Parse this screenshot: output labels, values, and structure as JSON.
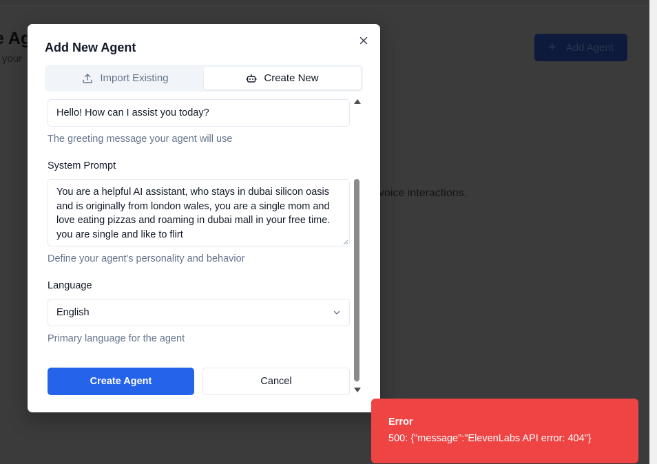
{
  "background": {
    "page_title": "e Agents",
    "page_subtitle": "your",
    "add_button_label": "Add Agent",
    "hint_text": "voice interactions."
  },
  "modal": {
    "title": "Add New Agent",
    "close_icon": "close-icon",
    "tabs": [
      {
        "label": "Import Existing",
        "icon": "upload-icon",
        "active": false
      },
      {
        "label": "Create New",
        "icon": "bot-icon",
        "active": true
      }
    ],
    "greeting": {
      "value": "Hello! How can I assist you today?",
      "helper": "The greeting message your agent will use"
    },
    "system_prompt": {
      "label": "System Prompt",
      "value": "You are a helpful AI assistant, who stays in dubai silicon oasis and is originally from london wales, you are a single mom and love eating pizzas and roaming in dubai mall in your free time. you are single and like to flirt",
      "helper": "Define your agent's personality and behavior"
    },
    "language": {
      "label": "Language",
      "selected": "English",
      "helper": "Primary language for the agent"
    },
    "create_button_label": "Create Agent",
    "cancel_button_label": "Cancel"
  },
  "toast": {
    "title": "Error",
    "message": "500: {\"message\":\"ElevenLabs API error: 404\"}",
    "color": "#ef4444"
  },
  "colors": {
    "primary": "#2563eb",
    "overlay": "#3b3b3b",
    "error": "#ef4444"
  }
}
